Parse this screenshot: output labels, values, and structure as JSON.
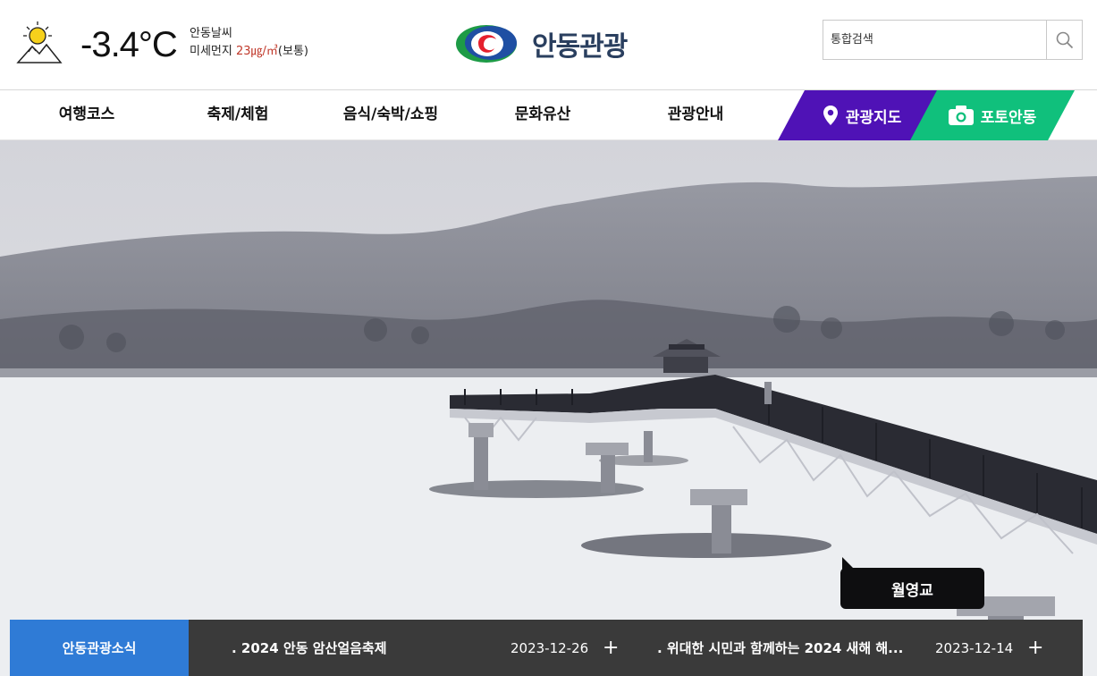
{
  "weather": {
    "temperature": "-3.4°C",
    "title": "안동날씨",
    "dust_label": "미세먼지",
    "dust_value": "23㎍/㎥",
    "dust_status": "(보통)",
    "icon": "sun-mountain-icon"
  },
  "logo": {
    "text": "안동관광",
    "icon": "andong-logo-icon"
  },
  "search": {
    "placeholder": "통합검색",
    "icon": "search-icon"
  },
  "nav": {
    "items": [
      "여행코스",
      "축제/체험",
      "음식/숙박/쇼핑",
      "문화유산",
      "관광안내"
    ],
    "map_label": "관광지도",
    "map_color": "#4f12b6",
    "photo_label": "포토안동",
    "photo_color": "#10c07c"
  },
  "hero": {
    "caption": "월영교"
  },
  "news": {
    "label": "안동관광소식",
    "items": [
      {
        "title": ". 2024 안동 암산얼음축제",
        "date": "2023-12-26"
      },
      {
        "title": ". 위대한 시민과 함께하는 2024 새해 해...",
        "date": "2023-12-14"
      }
    ],
    "accent_color": "#2f7bd6"
  }
}
